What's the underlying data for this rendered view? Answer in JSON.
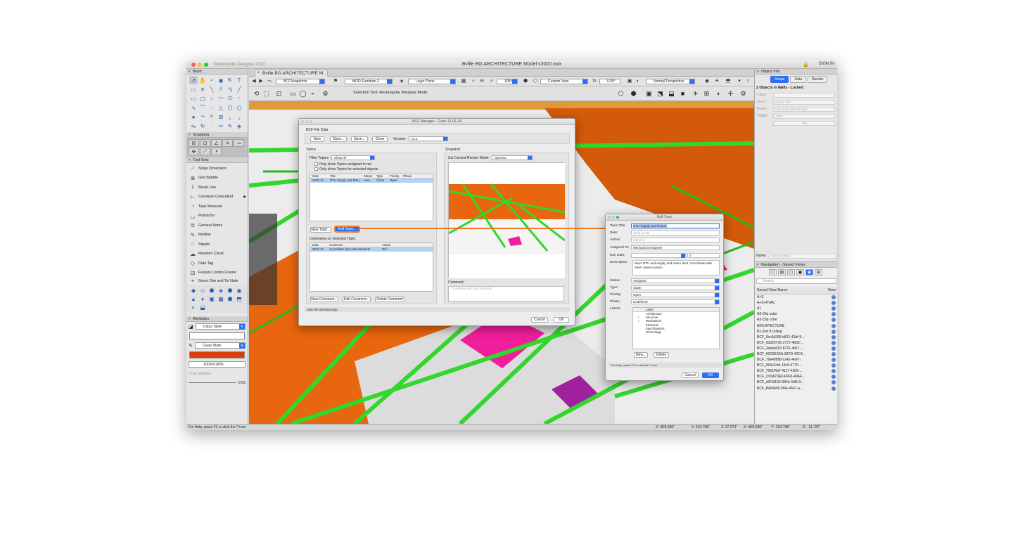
{
  "app": {
    "name": "Vectorworks Designer 2020",
    "document_title": "Bville BG ARCHITECTURE Model v2020.vwx",
    "sign_in": "SIGN IN"
  },
  "left_palettes": {
    "basic_title": "Basic",
    "snapping_title": "Snapping",
    "tool_sets_title": "Tool Sets",
    "tool_set_items": [
      {
        "label": "Slope Dimension",
        "icon": "slope-icon"
      },
      {
        "label": "Grid Bubble",
        "icon": "grid-bubble-icon"
      },
      {
        "label": "Break Line",
        "icon": "break-line-icon"
      },
      {
        "label": "Constrain Coincident",
        "icon": "constrain-icon"
      },
      {
        "label": "Tape Measure",
        "icon": "tape-measure-icon"
      },
      {
        "label": "Protractor",
        "icon": "protractor-icon"
      },
      {
        "label": "General Notes",
        "icon": "notes-icon"
      },
      {
        "label": "Redline",
        "icon": "redline-icon"
      },
      {
        "label": "Stipple",
        "icon": "stipple-icon"
      },
      {
        "label": "Revision Cloud",
        "icon": "cloud-icon"
      },
      {
        "label": "Data Tag",
        "icon": "tag-icon"
      },
      {
        "label": "Feature Control Frame",
        "icon": "fcf-icon"
      },
      {
        "label": "Geom Dim and Tol Note",
        "icon": "gdt-icon"
      }
    ],
    "attributes_title": "Attributes",
    "fill_class_style": "Class Style",
    "pen_class_style": "Class Style",
    "opacity": "100%/100%",
    "drop_shadow": "Drop Shadow",
    "line_weight": "0.05",
    "pen_color": "#d9400f"
  },
  "doc_tab": {
    "label": "Bville BG ARCHITECTURE M..."
  },
  "toolbar": {
    "saved_view": "BCFSnapshots",
    "class": "MOD-Furniture-2",
    "layer_plane": "Layer Plane",
    "zoom": "100%",
    "view": "Custom View",
    "rotation": "0.00°",
    "render_mode": "Normal Perspective",
    "tool_hint": "Selection Tool: Rectangular Marquee Mode"
  },
  "bcf_dialog": {
    "title": "BCF Manager - Clash 12-06-18",
    "file_data_label": "BCF File Data",
    "buttons": {
      "new": "New",
      "open": "Open...",
      "save": "Save...",
      "close": "Close"
    },
    "version_label": "Version:",
    "version": "v2.1",
    "topics_label": "Topics",
    "filter_label": "Filter Topics:",
    "filter_value": "Show All",
    "only_assigned": "Only show Topics assigned to me",
    "only_selected": "Only show Topics for selected objects",
    "topic_columns": [
      "Date",
      "Title",
      "Status",
      "Type",
      "Priority",
      "Phase"
    ],
    "topic_rows": [
      [
        "2018-12...",
        "RTU Supply and Retu...",
        "Assi...",
        "Clash",
        "Open",
        ""
      ]
    ],
    "new_topic": "New Topic...",
    "edit_topic": "Edit Topic...",
    "comments_label": "Comments on Selected Topic:",
    "comment_columns": [
      "Date",
      "Comment",
      "Author"
    ],
    "comment_rows": [
      [
        "2018-12...",
        "Coordinate duct with structural",
        "Ref..."
      ]
    ],
    "new_comment": "New Comment...",
    "edit_comment": "Edit Comment...",
    "delete_comment": "Delete Comment",
    "snapshot_label": "Snapshot",
    "render_mode_label": "Set Current Render Mode:",
    "render_mode": "OpenGL",
    "comment_label": "Comment:",
    "comment_placeholder": "Coordinate duct with structural",
    "help_text": "Edits the selected topic.",
    "cancel": "Cancel",
    "ok": "OK"
  },
  "edit_topic_dialog": {
    "title": "Edit Topic",
    "fields": {
      "topic_title_label": "Topic Title:",
      "topic_title": "RTU Supply and Return",
      "date_label": "Date:",
      "date": "2018-12-06",
      "author_label": "Author:",
      "author": "tefamino",
      "assigned_label": "Assigned To:",
      "assigned": "Mechanical engineer",
      "due_label": "Due Date:",
      "due_value": "0",
      "description_label": "Description:",
      "description": "Move RTU and supply and return duct.  Coordinate with Steel Joists location",
      "status_label": "Status:",
      "status": "Assigned",
      "type_label": "Type:",
      "type": "Clash",
      "priority_label": "Priority:",
      "priority": "Open",
      "phase_label": "Phase:",
      "phase": "Undefined",
      "labels_label": "Labels:"
    },
    "label_header": "Label",
    "labels": [
      {
        "name": "Architecture",
        "checked": false
      },
      {
        "name": "Structure",
        "checked": true
      },
      {
        "name": "Mechanical",
        "checked": true
      },
      {
        "name": "Electrical",
        "checked": false
      },
      {
        "name": "Specifications",
        "checked": false
      },
      {
        "name": "Technology",
        "checked": false
      }
    ],
    "check_glyph": "✓",
    "new": "New...",
    "delete": "Delete",
    "help_text": "For Help, press F1 or click the ? icon",
    "cancel": "Cancel",
    "ok": "OK"
  },
  "object_info": {
    "title": "Object Info",
    "tabs": [
      "Shape",
      "Data",
      "Render"
    ],
    "summary": "2 Objects in Walls - Locked",
    "rows": [
      {
        "label": "Class:",
        "value": ""
      },
      {
        "label": "Insert:",
        "value": "Center line"
      },
      {
        "label": "Break:",
        "value": "Full break without caps"
      },
      {
        "label": "Height:",
        "value": "-28'0\""
      }
    ],
    "flip": "Flip",
    "name_label": "Name:",
    "name_value": "<SELECTED>"
  },
  "navigation": {
    "title": "Navigation - Saved Views",
    "search_placeholder": "Search",
    "col_name": "Saved View Name",
    "col_view": "View",
    "views": [
      "A+S",
      "A+S+HVAC",
      "A1",
      "A2-Clip cube",
      "A3-Clip cube",
      "ARCHITECTURE",
      "B1-2nd fl ceiling",
      "BCF_0cc6d335-b821-41bf-9...",
      "BCF_0d325726-2737-48d3-...",
      "BCF_2ebab252-8721-4dc7-...",
      "BCF_6C065C5A-96FD-42C4...",
      "BCF_79e40988-ca41-4e97-...",
      "BCF_969c2cbf-13e9-4770-...",
      "BCF_7561f4d7-4117-4206-...",
      "BCF_C09A73E0-F0F0-40AF...",
      "BCF_d3f15160-384d-4df9-9...",
      "BCF_f6849ef5-3f44-4547-a..."
    ]
  },
  "status_bar": {
    "help": "For Help, press F1 or click the ? icon",
    "x1": "X: 38'8.090\"",
    "y1": "Y: 224.798\"",
    "z1": "Z: 27.273\"",
    "x2": "X: 38'8.090\"",
    "y2": "Y': 224.798\"",
    "z2": "Z': -11.727\""
  },
  "colors": {
    "accent": "#2f6df5",
    "callout": "#f07a23",
    "structure_green": "#33d62c",
    "duct_orange": "#e8660e",
    "magenta": "#f01e9a"
  }
}
